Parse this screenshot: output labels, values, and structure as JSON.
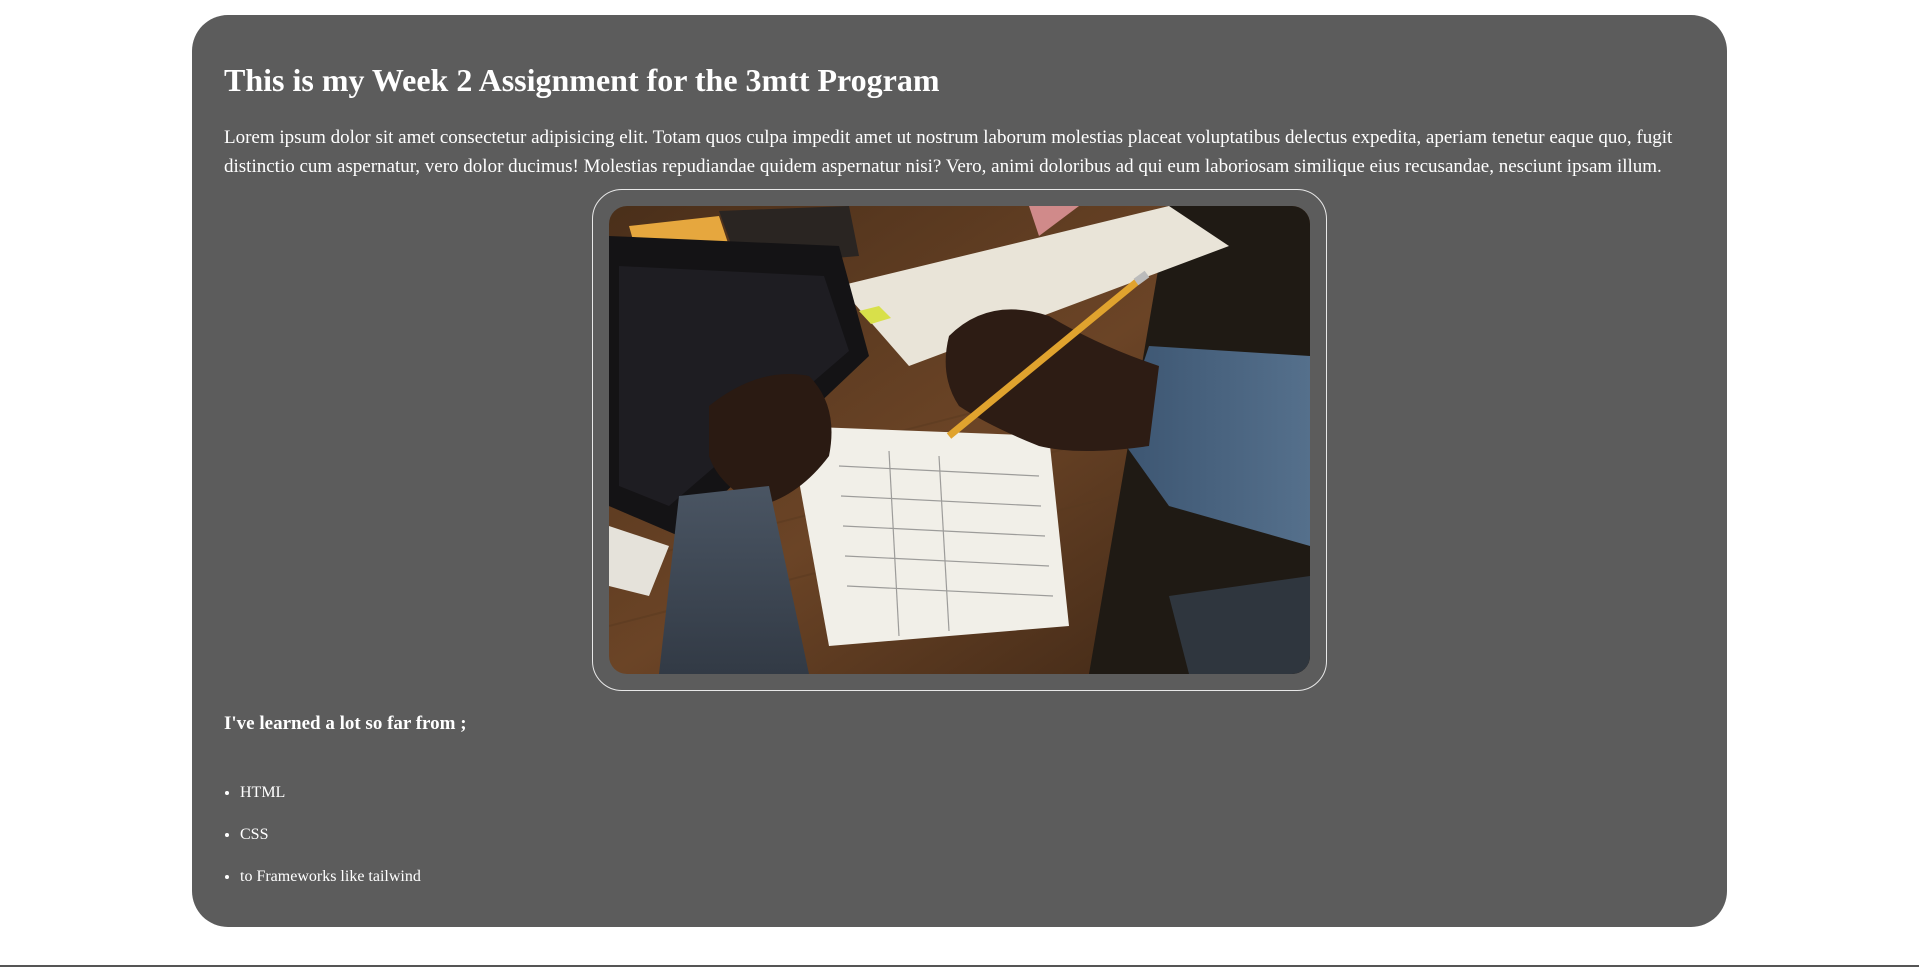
{
  "page": {
    "title": "This is my Week 2 Assignment for the 3mtt Program",
    "intro": "Lorem ipsum dolor sit amet consectetur adipisicing elit. Totam quos culpa impedit amet ut nostrum laborum molestias placeat voluptatibus delectus expedita, aperiam tenetur eaque quo, fugit distinctio cum aspernatur, vero dolor ducimus! Molestias repudiandae quidem aspernatur nisi? Vero, animi doloribus ad qui eum laboriosam similique eius recusandae, nesciunt ipsam illum.",
    "learned_heading": "I've learned a lot so far from ;",
    "learned_items": [
      "HTML",
      "CSS",
      "to Frameworks like tailwind"
    ]
  },
  "colors": {
    "card_bg": "#5c5c5c",
    "text": "#ffffff",
    "page_bg": "#ffffff"
  }
}
